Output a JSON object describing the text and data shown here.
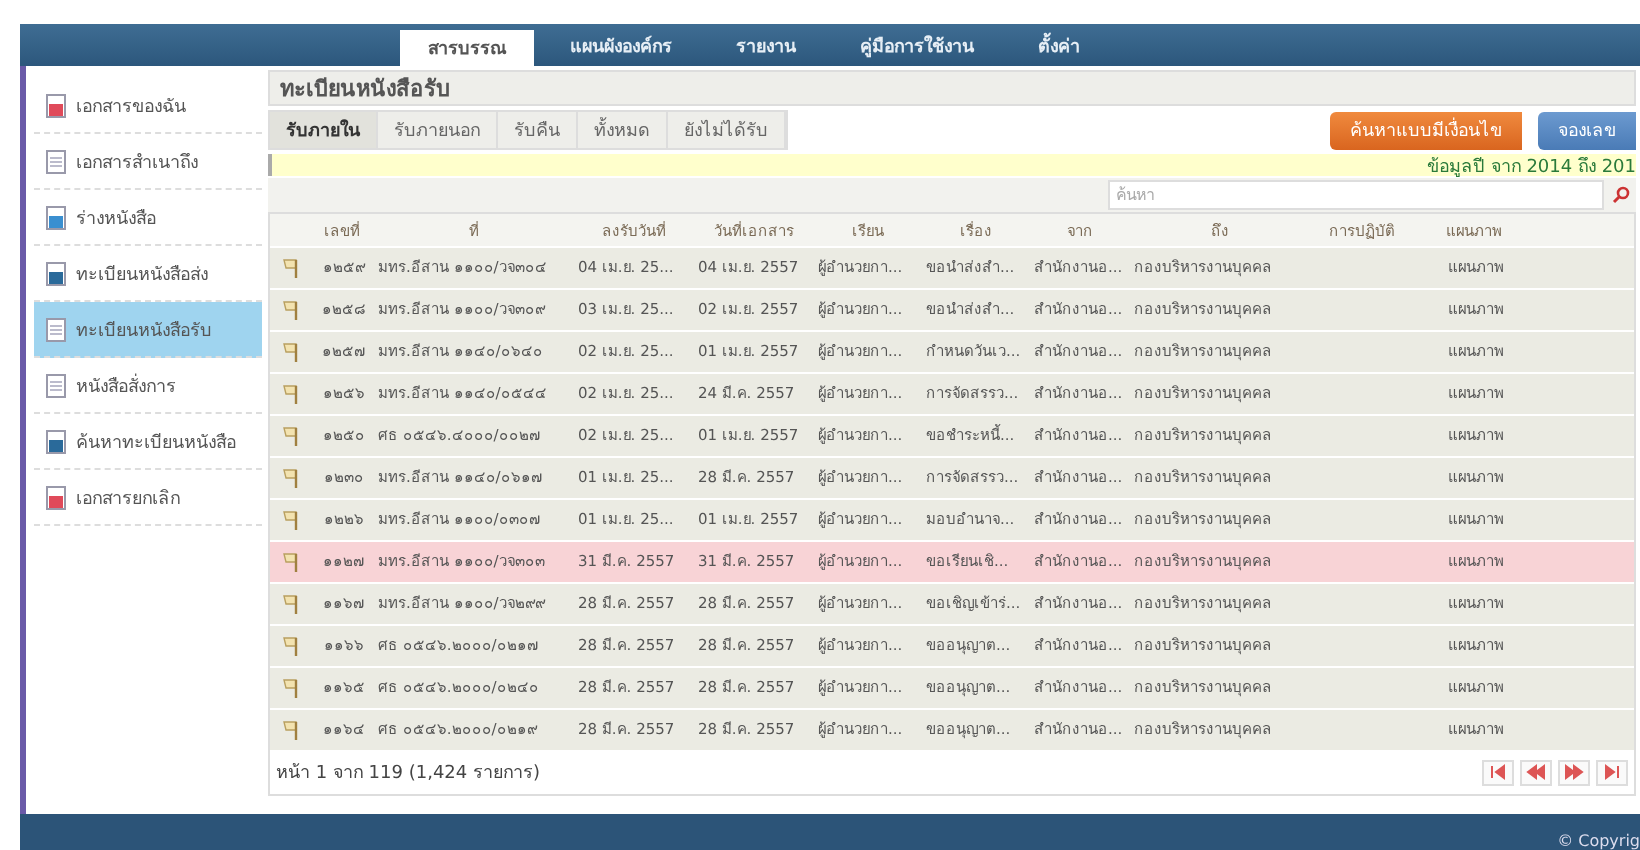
{
  "nav": {
    "tabs": [
      {
        "label": "สารบรรณ",
        "selected": true
      },
      {
        "label": "แผนผังองค์กร",
        "selected": false
      },
      {
        "label": "รายงาน",
        "selected": false
      },
      {
        "label": "คู่มือการใช้งาน",
        "selected": false
      },
      {
        "label": "ตั้งค่า",
        "selected": false
      }
    ]
  },
  "sidebar": {
    "items": [
      {
        "label": "เอกสารของฉัน",
        "selected": false
      },
      {
        "label": "เอกสารสำเนาถึง",
        "selected": false
      },
      {
        "label": "ร่างหนังสือ",
        "selected": false
      },
      {
        "label": "ทะเบียนหนังสือส่ง",
        "selected": false
      },
      {
        "label": "ทะเบียนหนังสือรับ",
        "selected": true
      },
      {
        "label": "หนังสือสั่งการ",
        "selected": false
      },
      {
        "label": "ค้นหาทะเบียนหนังสือ",
        "selected": false
      },
      {
        "label": "เอกสารยกเลิก",
        "selected": false
      }
    ]
  },
  "panel": {
    "title": "ทะเบียนหนังสือรับ",
    "tabs": [
      {
        "label": "รับภายใน",
        "selected": true
      },
      {
        "label": "รับภายนอก",
        "selected": false
      },
      {
        "label": "รับคืน",
        "selected": false
      },
      {
        "label": "ทั้งหมด",
        "selected": false
      },
      {
        "label": "ยังไม่ได้รับ",
        "selected": false
      }
    ],
    "buttons": [
      {
        "label": "ค้นหาแบบมีเงื่อนไข",
        "kind": "orange"
      },
      {
        "label": "จองเลข",
        "kind": "blue"
      }
    ],
    "info": "ข้อมูลปี จาก 2014 ถึง 201",
    "search": {
      "placeholder": "ค้นหา"
    },
    "table": {
      "columns": [
        "เลขที่",
        "ที่",
        "ลงรับวันที่",
        "วันที่เอกสาร",
        "เรียน",
        "เรื่อง",
        "จาก",
        "ถึง",
        "การปฏิบัติ",
        "แผนภาพ"
      ],
      "rows": [
        {
          "highlighted": false,
          "cells": [
            "๑๒๕๙",
            "มทร.อีสาน ๑๑๐๐/วจ๓๐๔",
            "04 เม.ย. 25...",
            "04 เม.ย. 2557",
            "ผู้อำนวยกา...",
            "ขอนำส่งสำ...",
            "สำนักงานอ...",
            "กองบริหารงานบุคคล",
            "",
            "แผนภาพ"
          ]
        },
        {
          "highlighted": false,
          "cells": [
            "๑๒๕๘",
            "มทร.อีสาน ๑๑๐๐/วจ๓๐๙",
            "03 เม.ย. 25...",
            "02 เม.ย. 2557",
            "ผู้อำนวยกา...",
            "ขอนำส่งสำ...",
            "สำนักงานอ...",
            "กองบริหารงานบุคคล",
            "",
            "แผนภาพ"
          ]
        },
        {
          "highlighted": false,
          "cells": [
            "๑๒๕๗",
            "มทร.อีสาน ๑๑๔๐/๐๖๔๐",
            "02 เม.ย. 25...",
            "01 เม.ย. 2557",
            "ผู้อำนวยกา...",
            "กำหนดวันเว...",
            "สำนักงานอ...",
            "กองบริหารงานบุคคล",
            "",
            "แผนภาพ"
          ]
        },
        {
          "highlighted": false,
          "cells": [
            "๑๒๕๖",
            "มทร.อีสาน ๑๑๔๐/๐๕๔๔",
            "02 เม.ย. 25...",
            "24 มี.ค. 2557",
            "ผู้อำนวยกา...",
            "การจัดสรรว...",
            "สำนักงานอ...",
            "กองบริหารงานบุคคล",
            "",
            "แผนภาพ"
          ]
        },
        {
          "highlighted": false,
          "cells": [
            "๑๒๕๐",
            "ศธ ๐๕๔๖.๔๐๐๐/๐๐๒๗",
            "02 เม.ย. 25...",
            "01 เม.ย. 2557",
            "ผู้อำนวยกา...",
            "ขอชำระหนี้...",
            "สำนักงานอ...",
            "กองบริหารงานบุคคล",
            "",
            "แผนภาพ"
          ]
        },
        {
          "highlighted": false,
          "cells": [
            "๑๒๓๐",
            "มทร.อีสาน ๑๑๔๐/๐๖๑๗",
            "01 เม.ย. 25...",
            "28 มี.ค. 2557",
            "ผู้อำนวยกา...",
            "การจัดสรรว...",
            "สำนักงานอ...",
            "กองบริหารงานบุคคล",
            "",
            "แผนภาพ"
          ]
        },
        {
          "highlighted": false,
          "cells": [
            "๑๒๒๖",
            "มทร.อีสาน ๑๑๐๐/๐๓๐๗",
            "01 เม.ย. 25...",
            "01 เม.ย. 2557",
            "ผู้อำนวยกา...",
            "มอบอำนาจ...",
            "สำนักงานอ...",
            "กองบริหารงานบุคคล",
            "",
            "แผนภาพ"
          ]
        },
        {
          "highlighted": true,
          "cells": [
            "๑๑๒๗",
            "มทร.อีสาน ๑๑๐๐/วจ๓๐๓",
            "31 มี.ค. 2557",
            "31 มี.ค. 2557",
            "ผู้อำนวยกา...",
            "ขอเรียนเชิ...",
            "สำนักงานอ...",
            "กองบริหารงานบุคคล",
            "",
            "แผนภาพ"
          ]
        },
        {
          "highlighted": false,
          "cells": [
            "๑๑๖๗",
            "มทร.อีสาน ๑๑๐๐/วจ๒๙๙",
            "28 มี.ค. 2557",
            "28 มี.ค. 2557",
            "ผู้อำนวยกา...",
            "ขอเชิญเข้าร่...",
            "สำนักงานอ...",
            "กองบริหารงานบุคคล",
            "",
            "แผนภาพ"
          ]
        },
        {
          "highlighted": false,
          "cells": [
            "๑๑๖๖",
            "ศธ ๐๕๔๖.๒๐๐๐/๐๒๑๗",
            "28 มี.ค. 2557",
            "28 มี.ค. 2557",
            "ผู้อำนวยกา...",
            "ขออนุญาต...",
            "สำนักงานอ...",
            "กองบริหารงานบุคคล",
            "",
            "แผนภาพ"
          ]
        },
        {
          "highlighted": false,
          "cells": [
            "๑๑๖๕",
            "ศธ ๐๕๔๖.๒๐๐๐/๐๒๔๐",
            "28 มี.ค. 2557",
            "28 มี.ค. 2557",
            "ผู้อำนวยกา...",
            "ขออนุญาต...",
            "สำนักงานอ...",
            "กองบริหารงานบุคคล",
            "",
            "แผนภาพ"
          ]
        },
        {
          "highlighted": false,
          "cells": [
            "๑๑๖๔",
            "ศธ ๐๕๔๖.๒๐๐๐/๐๒๑๙",
            "28 มี.ค. 2557",
            "28 มี.ค. 2557",
            "ผู้อำนวยกา...",
            "ขออนุญาต...",
            "สำนักงานอ...",
            "กองบริหารงานบุคคล",
            "",
            "แผนภาพ"
          ]
        }
      ]
    },
    "page_info": "หน้า 1 จาก 119 (1,424 รายการ)"
  },
  "footer": {
    "copyright": "© Copyrig"
  }
}
